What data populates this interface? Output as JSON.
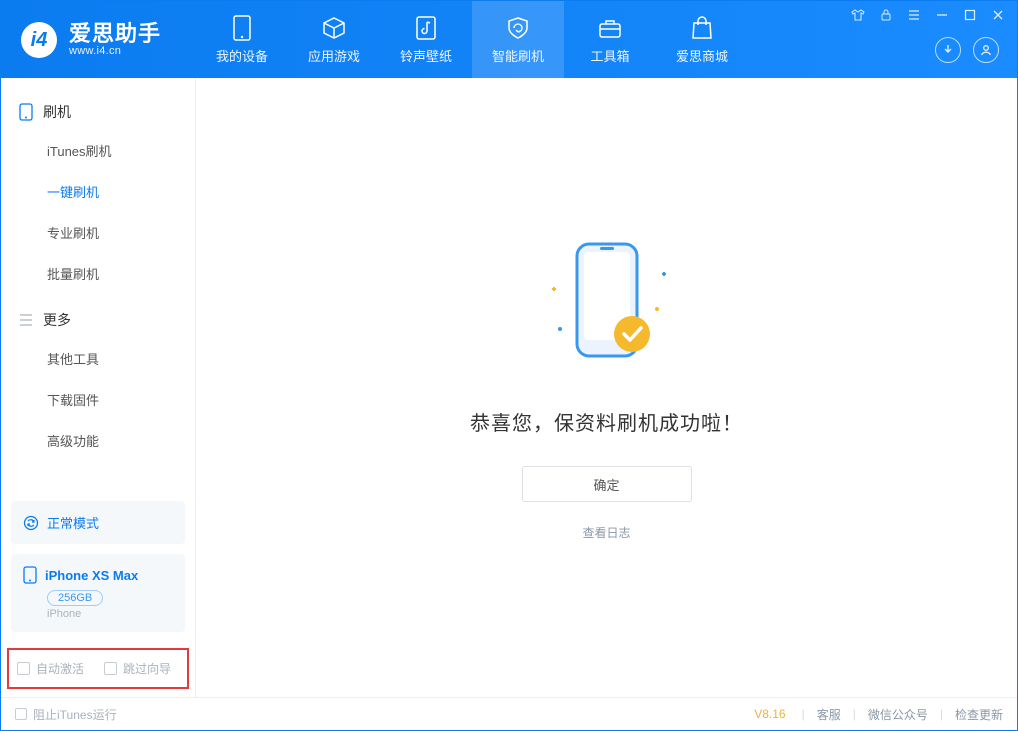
{
  "app": {
    "name": "爱思助手",
    "url": "www.i4.cn"
  },
  "nav": [
    {
      "label": "我的设备"
    },
    {
      "label": "应用游戏"
    },
    {
      "label": "铃声壁纸"
    },
    {
      "label": "智能刷机",
      "active": true
    },
    {
      "label": "工具箱"
    },
    {
      "label": "爱思商城"
    }
  ],
  "sidebar": {
    "section1_title": "刷机",
    "section1_items": [
      {
        "label": "iTunes刷机"
      },
      {
        "label": "一键刷机",
        "active": true
      },
      {
        "label": "专业刷机"
      },
      {
        "label": "批量刷机"
      }
    ],
    "section2_title": "更多",
    "section2_items": [
      {
        "label": "其他工具"
      },
      {
        "label": "下载固件"
      },
      {
        "label": "高级功能"
      }
    ],
    "mode": "正常模式",
    "device_name": "iPhone XS Max",
    "device_storage": "256GB",
    "device_type": "iPhone",
    "option_auto_activate": "自动激活",
    "option_skip_wizard": "跳过向导"
  },
  "main": {
    "title": "恭喜您，保资料刷机成功啦！",
    "confirm": "确定",
    "view_log": "查看日志"
  },
  "statusbar": {
    "block_itunes": "阻止iTunes运行",
    "version": "V8.16",
    "support": "客服",
    "wechat": "微信公众号",
    "check_update": "检查更新"
  }
}
